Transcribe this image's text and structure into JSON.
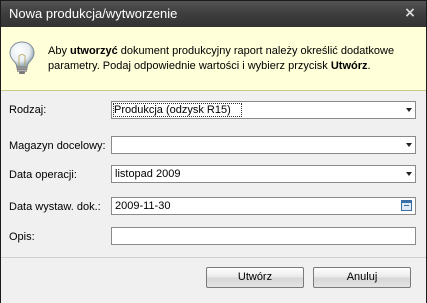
{
  "window": {
    "title": "Nowa produkcja/wytworzenie",
    "close_glyph": "×"
  },
  "info": {
    "icon": "lightbulb-icon",
    "text_before": "Aby ",
    "text_bold1": "utworzyć",
    "text_middle": " dokument produkcyjny raport należy określić dodatkowe parametry. Podaj odpowiednie wartości i wybierz przycisk ",
    "text_bold2": "Utwórz",
    "text_end": "."
  },
  "form": {
    "rodzaj": {
      "label": "Rodzaj:",
      "value": "Produkcja (odzysk R15)"
    },
    "magazyn": {
      "label": "Magazyn docelowy:",
      "value": ""
    },
    "data_operacji": {
      "label": "Data operacji:",
      "value": "listopad 2009"
    },
    "data_wystaw": {
      "label": "Data wystaw. dok.:",
      "value": "2009-11-30"
    },
    "opis": {
      "label": "Opis:",
      "value": ""
    }
  },
  "buttons": {
    "create": "Utwórz",
    "cancel": "Anuluj"
  },
  "colors": {
    "info_bg": "#ffffd9",
    "titlebar": "#3d3d3d"
  }
}
